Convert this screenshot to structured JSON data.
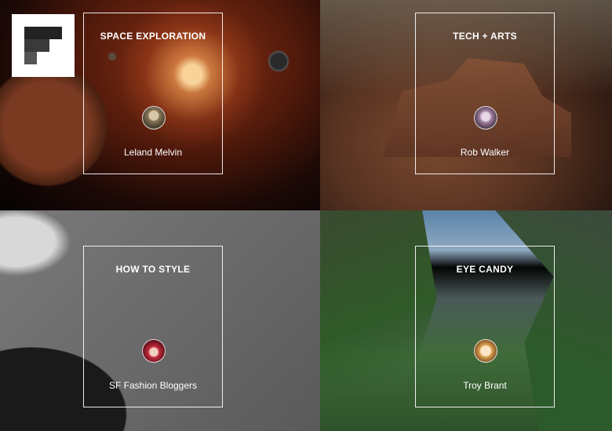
{
  "tiles": [
    {
      "title": "SPACE EXPLORATION",
      "author": "Leland Melvin",
      "avatar_color": "#8a7a5a"
    },
    {
      "title": "TECH + ARTS",
      "author": "Rob Walker",
      "avatar_color": "#9a7a9a"
    },
    {
      "title": "HOW TO STYLE",
      "author": "SF Fashion Bloggers",
      "avatar_color": "#c22a3a"
    },
    {
      "title": "EYE CANDY",
      "author": "Troy Brant",
      "avatar_color": "#d8a050"
    }
  ],
  "logo": "flipboard-logo"
}
